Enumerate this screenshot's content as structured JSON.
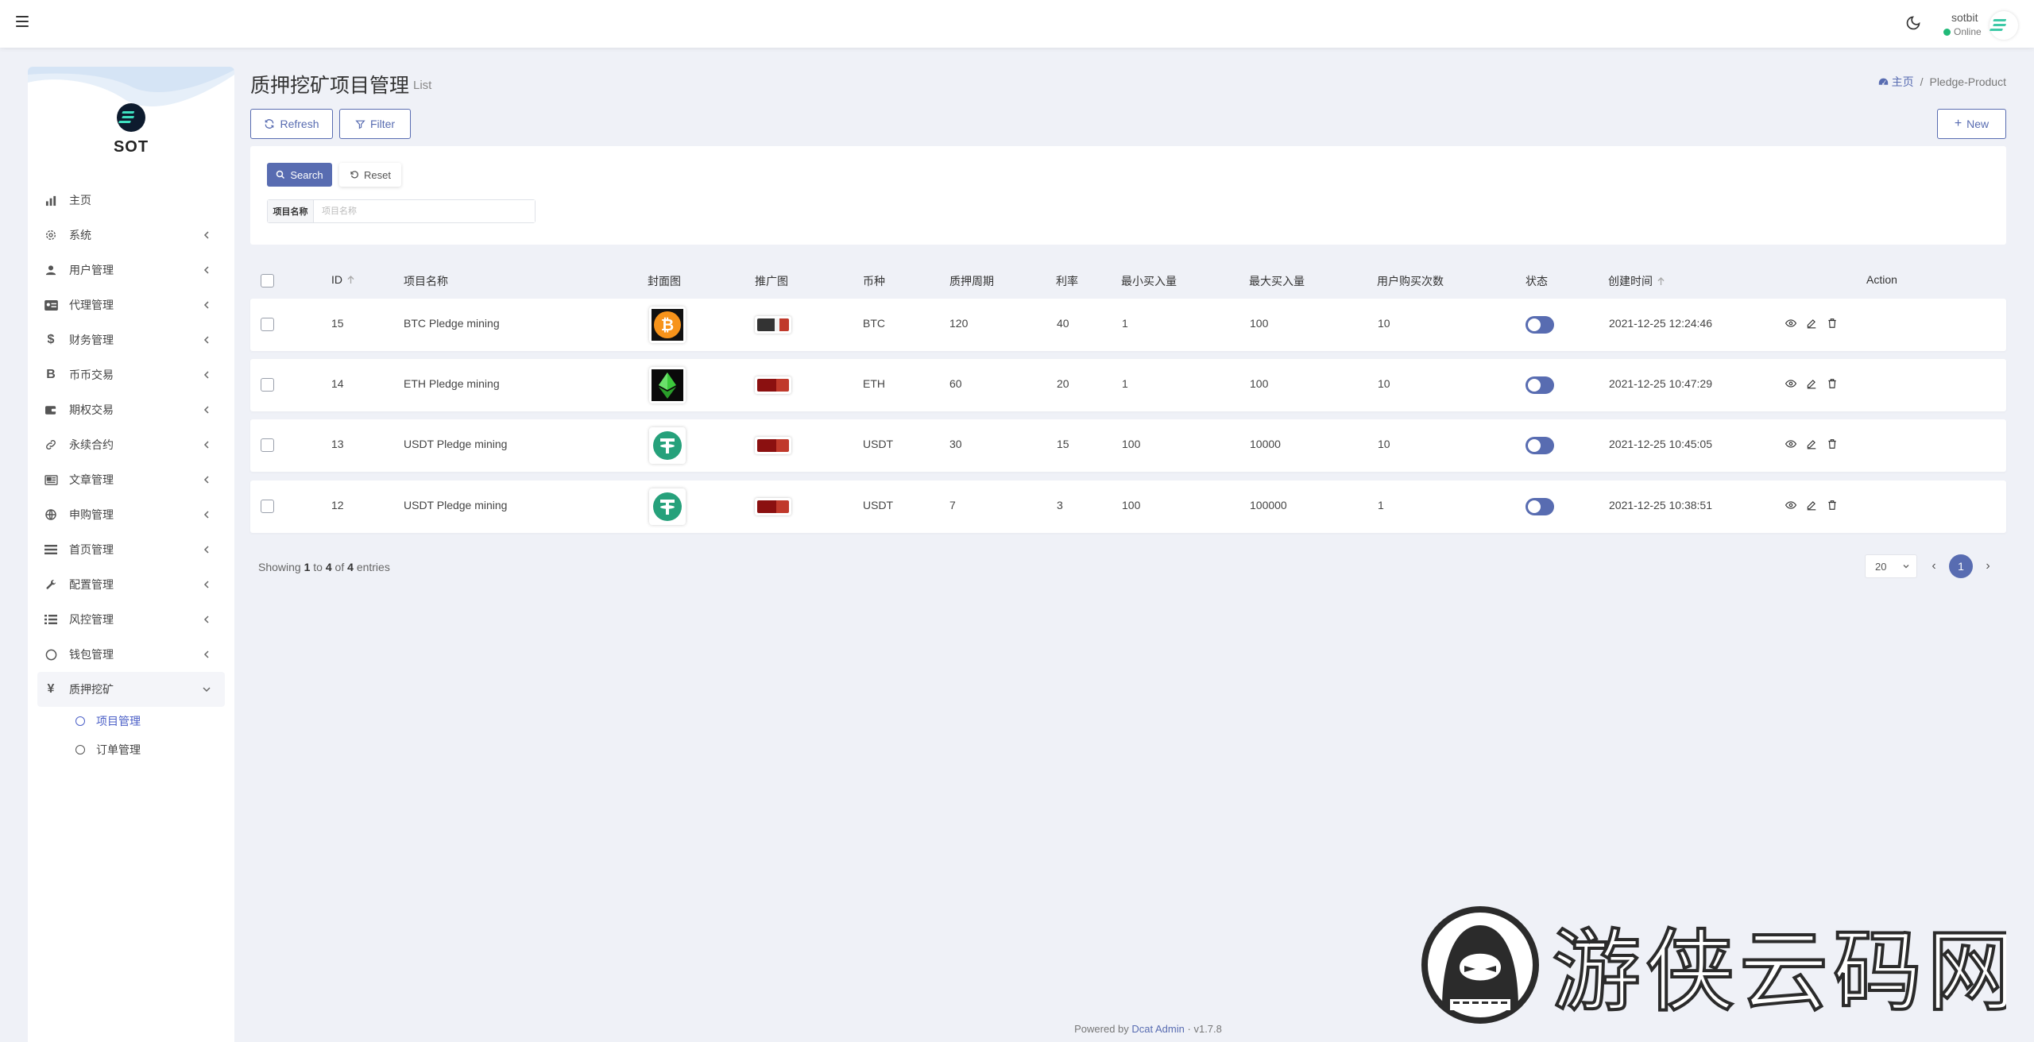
{
  "header": {
    "user_name": "sotbit",
    "user_status": "Online"
  },
  "sidebar": {
    "brand": "SOT",
    "items": [
      {
        "label": "主页",
        "icon": "bar-chart-icon",
        "glyph": "",
        "has_chevron": false
      },
      {
        "label": "系统",
        "icon": "gear-icon",
        "glyph": "",
        "has_chevron": true
      },
      {
        "label": "用户管理",
        "icon": "user-icon",
        "glyph": "",
        "has_chevron": true
      },
      {
        "label": "代理管理",
        "icon": "id-card-icon",
        "glyph": "",
        "has_chevron": true
      },
      {
        "label": "财务管理",
        "icon": "dollar-icon",
        "glyph": "$",
        "has_chevron": true
      },
      {
        "label": "币币交易",
        "icon": "bitcoin-icon",
        "glyph": "B",
        "has_chevron": true
      },
      {
        "label": "期权交易",
        "icon": "wallet-icon",
        "glyph": "",
        "has_chevron": true
      },
      {
        "label": "永续合约",
        "icon": "link-icon",
        "glyph": "",
        "has_chevron": true
      },
      {
        "label": "文章管理",
        "icon": "newspaper-icon",
        "glyph": "",
        "has_chevron": true
      },
      {
        "label": "申购管理",
        "icon": "globe-icon",
        "glyph": "",
        "has_chevron": true
      },
      {
        "label": "首页管理",
        "icon": "list-icon",
        "glyph": "",
        "has_chevron": true
      },
      {
        "label": "配置管理",
        "icon": "wrench-icon",
        "glyph": "",
        "has_chevron": true
      },
      {
        "label": "风控管理",
        "icon": "tasks-icon",
        "glyph": "",
        "has_chevron": true
      },
      {
        "label": "钱包管理",
        "icon": "circle-icon",
        "glyph": "",
        "has_chevron": true
      }
    ],
    "active_parent": {
      "label": "质押挖矿",
      "icon": "yen-icon",
      "glyph": "¥"
    },
    "sub_items": [
      {
        "label": "项目管理",
        "active": true
      },
      {
        "label": "订单管理",
        "active": false
      }
    ]
  },
  "page": {
    "title": "质押挖矿项目管理",
    "subtitle": "List",
    "breadcrumb_home": "主页",
    "breadcrumb_sep": "/",
    "breadcrumb_current": "Pledge-Product"
  },
  "toolbar": {
    "refresh_label": "Refresh",
    "filter_label": "Filter",
    "new_label": "New"
  },
  "filter": {
    "search_label": "Search",
    "reset_label": "Reset",
    "field_label": "项目名称",
    "field_placeholder": "项目名称",
    "field_value": ""
  },
  "table": {
    "columns": {
      "id": "ID",
      "name": "项目名称",
      "cover": "封面图",
      "promo": "推广图",
      "coin": "币种",
      "period": "质押周期",
      "rate": "利率",
      "min_buy": "最小买入量",
      "max_buy": "最大买入量",
      "user_times": "用户购买次数",
      "status": "状态",
      "created": "创建时间",
      "action": "Action"
    },
    "rows": [
      {
        "id": "15",
        "name": "BTC Pledge mining",
        "coin": "BTC",
        "period": "120",
        "rate": "40",
        "min_buy": "1",
        "max_buy": "100",
        "user_times": "10",
        "created": "2021-12-25 12:24:46"
      },
      {
        "id": "14",
        "name": "ETH Pledge mining",
        "coin": "ETH",
        "period": "60",
        "rate": "20",
        "min_buy": "1",
        "max_buy": "100",
        "user_times": "10",
        "created": "2021-12-25 10:47:29"
      },
      {
        "id": "13",
        "name": "USDT Pledge mining",
        "coin": "USDT",
        "period": "30",
        "rate": "15",
        "min_buy": "100",
        "max_buy": "10000",
        "user_times": "10",
        "created": "2021-12-25 10:45:05"
      },
      {
        "id": "12",
        "name": "USDT Pledge mining",
        "coin": "USDT",
        "period": "7",
        "rate": "3",
        "min_buy": "100",
        "max_buy": "100000",
        "user_times": "1",
        "created": "2021-12-25 10:38:51"
      }
    ]
  },
  "pagination": {
    "showing_prefix": "Showing",
    "from": "1",
    "to_word": "to",
    "to": "4",
    "of_word": "of",
    "total": "4",
    "entries_word": "entries",
    "page_size": "20",
    "current_page": "1"
  },
  "footer": {
    "powered_prefix": "Powered by",
    "powered_link": "Dcat Admin",
    "separator": "·",
    "version": "v1.7.8"
  },
  "watermark": {
    "text": "游侠云码网"
  },
  "colors": {
    "primary": "#586cb1",
    "online": "#21b978",
    "btc": "#f7931a",
    "usdt": "#26a17b",
    "eth": "#3cc93c"
  }
}
